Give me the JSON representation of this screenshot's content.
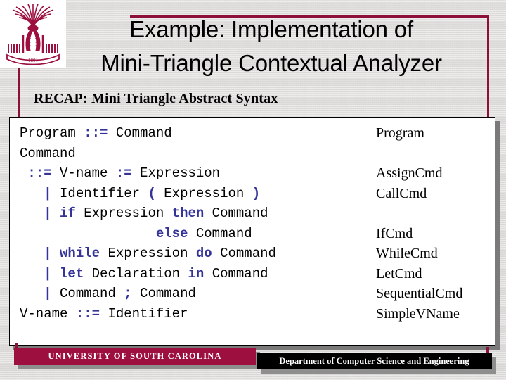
{
  "slide": {
    "title": "Example: Implementation of\nMini-Triangle Contextual Analyzer",
    "subtitle": "RECAP: Mini Triangle Abstract Syntax"
  },
  "logo": {
    "name": "usc-palmetto-logo",
    "color": "#9c0f3e",
    "banner_text": "1801"
  },
  "grammar": {
    "lines": [
      [
        {
          "t": "Program ",
          "k": false
        },
        {
          "t": "::=",
          "k": true
        },
        {
          "t": " Command",
          "k": false
        }
      ],
      [
        {
          "t": "Command",
          "k": false
        }
      ],
      [
        {
          "t": " ",
          "k": false
        },
        {
          "t": "::=",
          "k": true
        },
        {
          "t": " V-name ",
          "k": false
        },
        {
          "t": ":=",
          "k": true
        },
        {
          "t": " Expression",
          "k": false
        }
      ],
      [
        {
          "t": "   ",
          "k": false
        },
        {
          "t": "|",
          "k": true
        },
        {
          "t": " Identifier ",
          "k": false
        },
        {
          "t": "(",
          "k": true
        },
        {
          "t": " Expression ",
          "k": false
        },
        {
          "t": ")",
          "k": true
        }
      ],
      [
        {
          "t": "   ",
          "k": false
        },
        {
          "t": "|",
          "k": true
        },
        {
          "t": " ",
          "k": false
        },
        {
          "t": "if",
          "k": true
        },
        {
          "t": " Expression ",
          "k": false
        },
        {
          "t": "then",
          "k": true
        },
        {
          "t": " Command",
          "k": false
        }
      ],
      [
        {
          "t": "                 ",
          "k": false
        },
        {
          "t": "else",
          "k": true
        },
        {
          "t": " Command",
          "k": false
        }
      ],
      [
        {
          "t": "   ",
          "k": false
        },
        {
          "t": "|",
          "k": true
        },
        {
          "t": " ",
          "k": false
        },
        {
          "t": "while",
          "k": true
        },
        {
          "t": " Expression ",
          "k": false
        },
        {
          "t": "do",
          "k": true
        },
        {
          "t": " Command",
          "k": false
        }
      ],
      [
        {
          "t": "   ",
          "k": false
        },
        {
          "t": "|",
          "k": true
        },
        {
          "t": " ",
          "k": false
        },
        {
          "t": "let",
          "k": true
        },
        {
          "t": " Declaration ",
          "k": false
        },
        {
          "t": "in",
          "k": true
        },
        {
          "t": " Command",
          "k": false
        }
      ],
      [
        {
          "t": "   ",
          "k": false
        },
        {
          "t": "|",
          "k": true
        },
        {
          "t": " Command ",
          "k": false
        },
        {
          "t": ";",
          "k": true
        },
        {
          "t": " Command",
          "k": false
        }
      ],
      [
        {
          "t": "V-name ",
          "k": false
        },
        {
          "t": "::=",
          "k": true
        },
        {
          "t": " Identifier",
          "k": false
        }
      ],
      [
        {
          "t": "",
          "k": false
        }
      ],
      [
        {
          "t": "…",
          "k": false
        }
      ]
    ],
    "keyword_color": "#333399"
  },
  "ast_nodes": {
    "lines": [
      "Program",
      "",
      "AssignCmd",
      "CallCmd",
      "",
      "IfCmd",
      "WhileCmd",
      "LetCmd",
      "SequentialCmd",
      "SimpleVName"
    ]
  },
  "footer": {
    "university": "UNIVERSITY OF SOUTH CAROLINA",
    "department": "Department of Computer Science and Engineering",
    "university_bar_color": "#9c0f3e",
    "department_bar_color": "#000000"
  }
}
